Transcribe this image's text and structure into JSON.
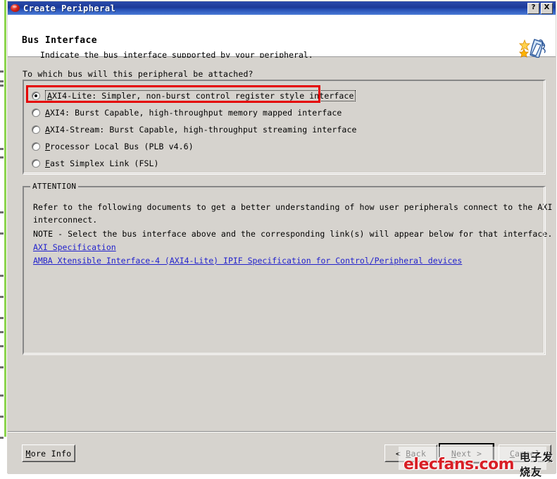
{
  "window": {
    "title": "Create Peripheral",
    "icon": "app-logo-icon",
    "help_button": "?",
    "close_button": "X"
  },
  "header": {
    "title": "Bus Interface",
    "subtitle": "Indicate the bus interface supported by your peripheral.",
    "icon": "wizard-puzzle-icon"
  },
  "main": {
    "question": "To which bus will this peripheral be attached?",
    "bus_options": [
      {
        "label": "AXI4-Lite: Simpler, non-burst control register style interface",
        "accel": "A",
        "selected": true,
        "focused": true
      },
      {
        "label": "AXI4: Burst Capable, high-throughput memory mapped interface",
        "accel": "A",
        "selected": false,
        "focused": false
      },
      {
        "label": "AXI4-Stream: Burst Capable, high-throughput streaming interface",
        "accel": "A",
        "selected": false,
        "focused": false
      },
      {
        "label": "Processor Local Bus (PLB v4.6)",
        "accel": "P",
        "selected": false,
        "focused": false
      },
      {
        "label": "Fast Simplex Link (FSL)",
        "accel": "F",
        "selected": false,
        "focused": false
      }
    ],
    "highlight_color": "#e50000"
  },
  "attention": {
    "legend": "ATTENTION",
    "lines": [
      "Refer to the following documents to get a better understanding of how user peripherals connect to the AXI bus",
      "interconnect.",
      "NOTE - Select the bus interface above and the corresponding link(s) will appear below for that interface."
    ],
    "links": [
      "AXI Specification",
      "AMBA Xtensible Interface-4 (AXI4-Lite) IPIF Specification for Control/Peripheral devices"
    ],
    "link_color": "#2222cc"
  },
  "buttons": {
    "more_info": "More Info",
    "more_info_accel": "M",
    "back": "< Back",
    "back_accel": "B",
    "next": "Next >",
    "next_accel": "N",
    "cancel": "Cancel",
    "cancel_accel": "C"
  },
  "watermark": {
    "english": "elecfans.com",
    "chinese": "电子发烧友",
    "color": "#d81f26"
  }
}
